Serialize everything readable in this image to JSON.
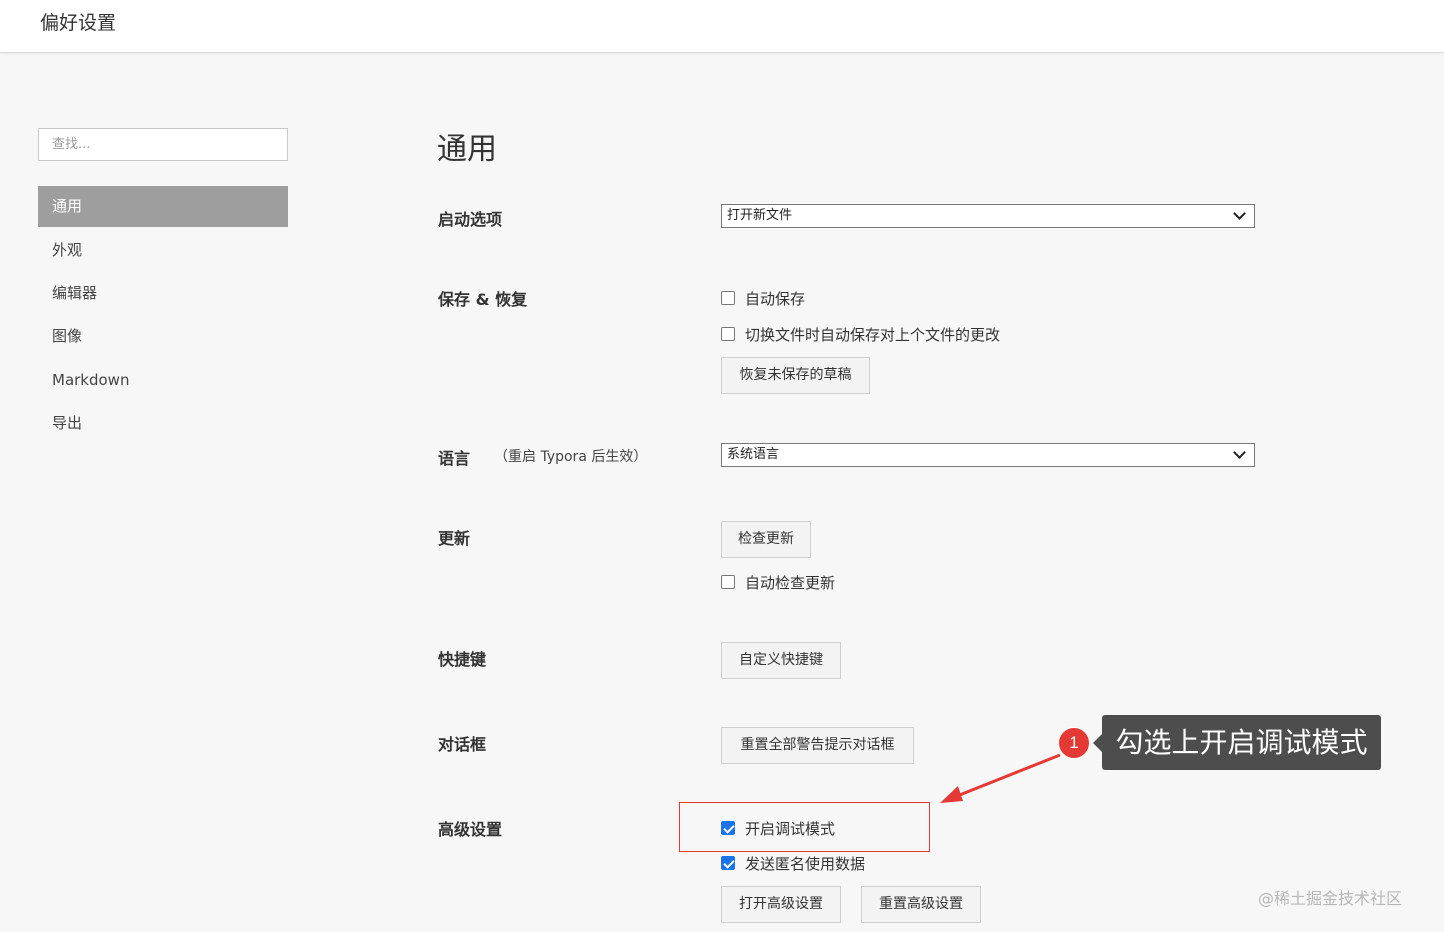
{
  "window": {
    "title": "偏好设置"
  },
  "sidebar": {
    "search_placeholder": "查找...",
    "items": [
      {
        "label": "通用",
        "active": true
      },
      {
        "label": "外观"
      },
      {
        "label": "编辑器"
      },
      {
        "label": "图像"
      },
      {
        "label": "Markdown"
      },
      {
        "label": "导出"
      }
    ]
  },
  "main": {
    "title": "通用",
    "startup": {
      "label": "启动选项",
      "value": "打开新文件"
    },
    "save_restore": {
      "label": "保存 & 恢复",
      "autosave": {
        "label": "自动保存",
        "checked": false
      },
      "autosave_on_switch": {
        "label": "切换文件时自动保存对上个文件的更改",
        "checked": false
      },
      "restore_button": "恢复未保存的草稿"
    },
    "language": {
      "label": "语言",
      "hint": "（重启 Typora 后生效）",
      "value": "系统语言"
    },
    "update": {
      "label": "更新",
      "check_button": "检查更新",
      "auto_check": {
        "label": "自动检查更新",
        "checked": false
      }
    },
    "shortcuts": {
      "label": "快捷键",
      "button": "自定义快捷键"
    },
    "dialogs": {
      "label": "对话框",
      "button": "重置全部警告提示对话框"
    },
    "advanced": {
      "label": "高级设置",
      "debug_mode": {
        "label": "开启调试模式",
        "checked": true
      },
      "send_usage": {
        "label": "发送匿名使用数据",
        "checked": true
      },
      "open_button": "打开高级设置",
      "reset_button": "重置高级设置"
    }
  },
  "annotation": {
    "number": "1",
    "text": "勾选上开启调试模式",
    "color": "#e53935"
  },
  "watermark": "@稀土掘金技术社区"
}
